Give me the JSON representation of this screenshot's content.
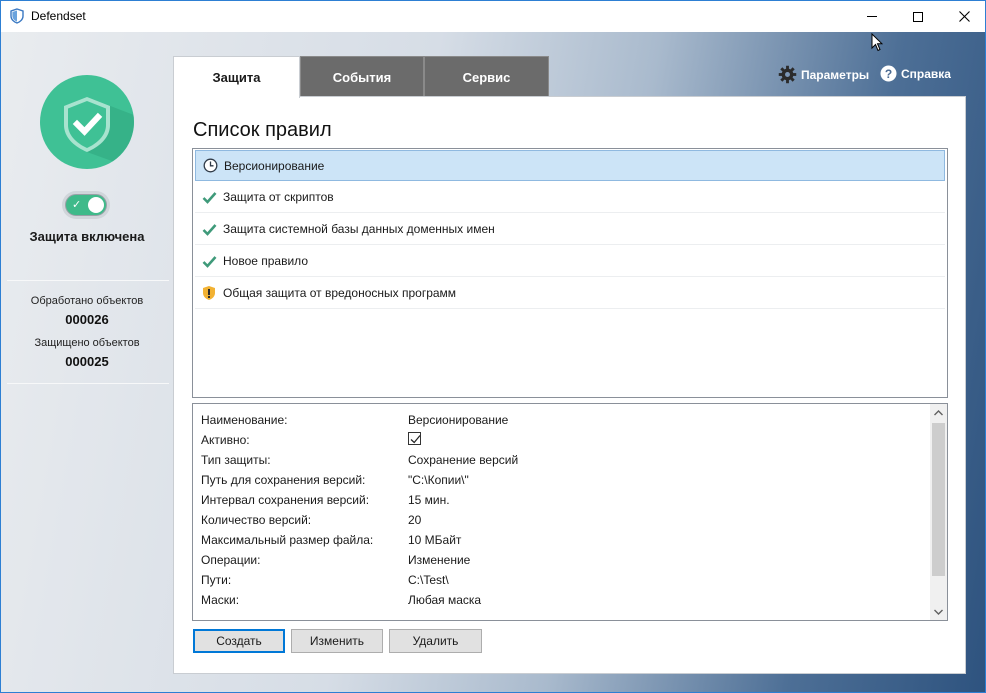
{
  "window": {
    "title": "Defendset"
  },
  "sidebar": {
    "protection_status": "Защита включена",
    "toggle_on": true,
    "stats": [
      {
        "label": "Обработано объектов",
        "value": "000026"
      },
      {
        "label": "Защищено объектов",
        "value": "000025"
      }
    ]
  },
  "tabs": [
    {
      "label": "Защита",
      "active": true
    },
    {
      "label": "События",
      "active": false
    },
    {
      "label": "Сервис",
      "active": false
    }
  ],
  "top_links": {
    "params": "Параметры",
    "help": "Справка"
  },
  "main": {
    "title": "Список правил",
    "rules": [
      {
        "label": "Версионирование",
        "icon": "clock-icon",
        "selected": true
      },
      {
        "label": "Защита от скриптов",
        "icon": "check-icon",
        "selected": false
      },
      {
        "label": "Защита системной базы данных доменных имен",
        "icon": "check-icon",
        "selected": false
      },
      {
        "label": "Новое правило",
        "icon": "check-icon",
        "selected": false
      },
      {
        "label": "Общая защита от вредоносных программ",
        "icon": "warning-shield-icon",
        "selected": false
      }
    ],
    "properties": [
      {
        "name": "Наименование:",
        "value": "Версионирование"
      },
      {
        "name": "Активно:",
        "value": "",
        "checkbox": true
      },
      {
        "name": "Тип защиты:",
        "value": "Сохранение версий"
      },
      {
        "name": "Путь для сохранения версий:",
        "value": "\"C:\\Копии\\\""
      },
      {
        "name": "Интервал сохранения версий:",
        "value": "15 мин."
      },
      {
        "name": "Количество версий:",
        "value": "20"
      },
      {
        "name": "Максимальный размер файла:",
        "value": "10 МБайт"
      },
      {
        "name": "Операции:",
        "value": "Изменение"
      },
      {
        "name": "Пути:",
        "value": "C:\\Test\\"
      },
      {
        "name": "Маски:",
        "value": "Любая маска"
      }
    ],
    "buttons": {
      "create": "Создать",
      "edit": "Изменить",
      "delete": "Удалить"
    }
  },
  "colors": {
    "accent_green": "#3fc195",
    "selection": "#cce4f7",
    "tab_inactive": "#6b6b6b"
  }
}
